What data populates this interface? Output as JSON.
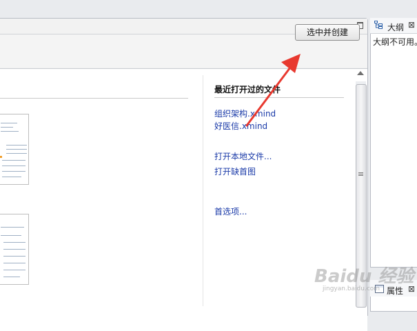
{
  "editor": {
    "primary_button": "选中并创建",
    "window_controls": [
      "minimize-icon",
      "maximize-icon"
    ]
  },
  "recent": {
    "title": "最近打开过的文件",
    "files": [
      "组织架构.xmind",
      "好医信.xmind"
    ]
  },
  "actions": {
    "open_local": "打开本地文件...",
    "open_missing": "打开缺首图",
    "preferences": "首选项..."
  },
  "outline": {
    "tab_label": "大纲",
    "message": "大纲不可用。",
    "close_glyph": "⊠"
  },
  "properties": {
    "tab_label": "属性",
    "close_glyph": "⊠"
  },
  "watermark": {
    "text": "Baidu 经验",
    "url": "jingyan.baidu.com"
  },
  "colors": {
    "link": "#1a3aa8",
    "annotation_arrow": "#e8392f",
    "panel_border": "#b8bcc4"
  }
}
